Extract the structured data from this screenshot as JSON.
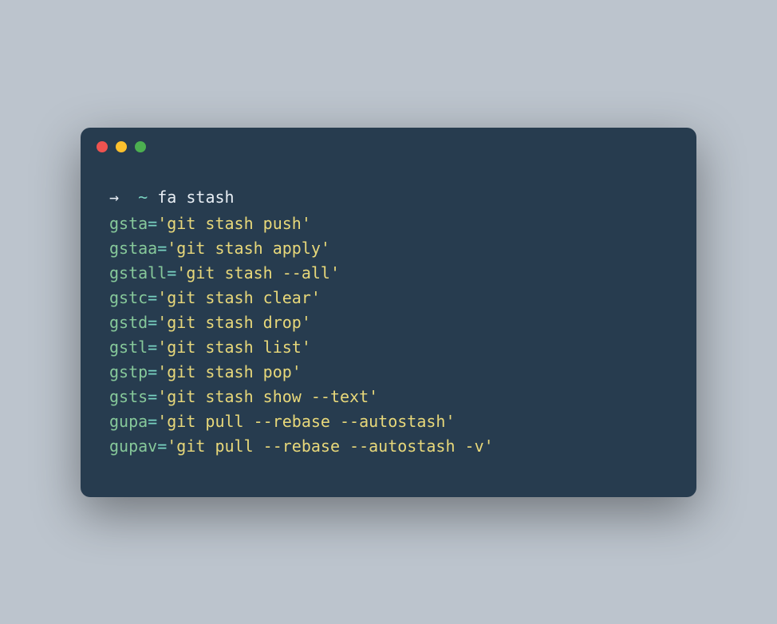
{
  "prompt": {
    "arrow": "→",
    "path": "~",
    "command": "fa stash"
  },
  "aliases": [
    {
      "name": "gsta",
      "value": "'git stash push'"
    },
    {
      "name": "gstaa",
      "value": "'git stash apply'"
    },
    {
      "name": "gstall",
      "value": "'git stash --all'"
    },
    {
      "name": "gstc",
      "value": "'git stash clear'"
    },
    {
      "name": "gstd",
      "value": "'git stash drop'"
    },
    {
      "name": "gstl",
      "value": "'git stash list'"
    },
    {
      "name": "gstp",
      "value": "'git stash pop'"
    },
    {
      "name": "gsts",
      "value": "'git stash show --text'"
    },
    {
      "name": "gupa",
      "value": "'git pull --rebase --autostash'"
    },
    {
      "name": "gupav",
      "value": "'git pull --rebase --autostash -v'"
    }
  ],
  "equals": "="
}
